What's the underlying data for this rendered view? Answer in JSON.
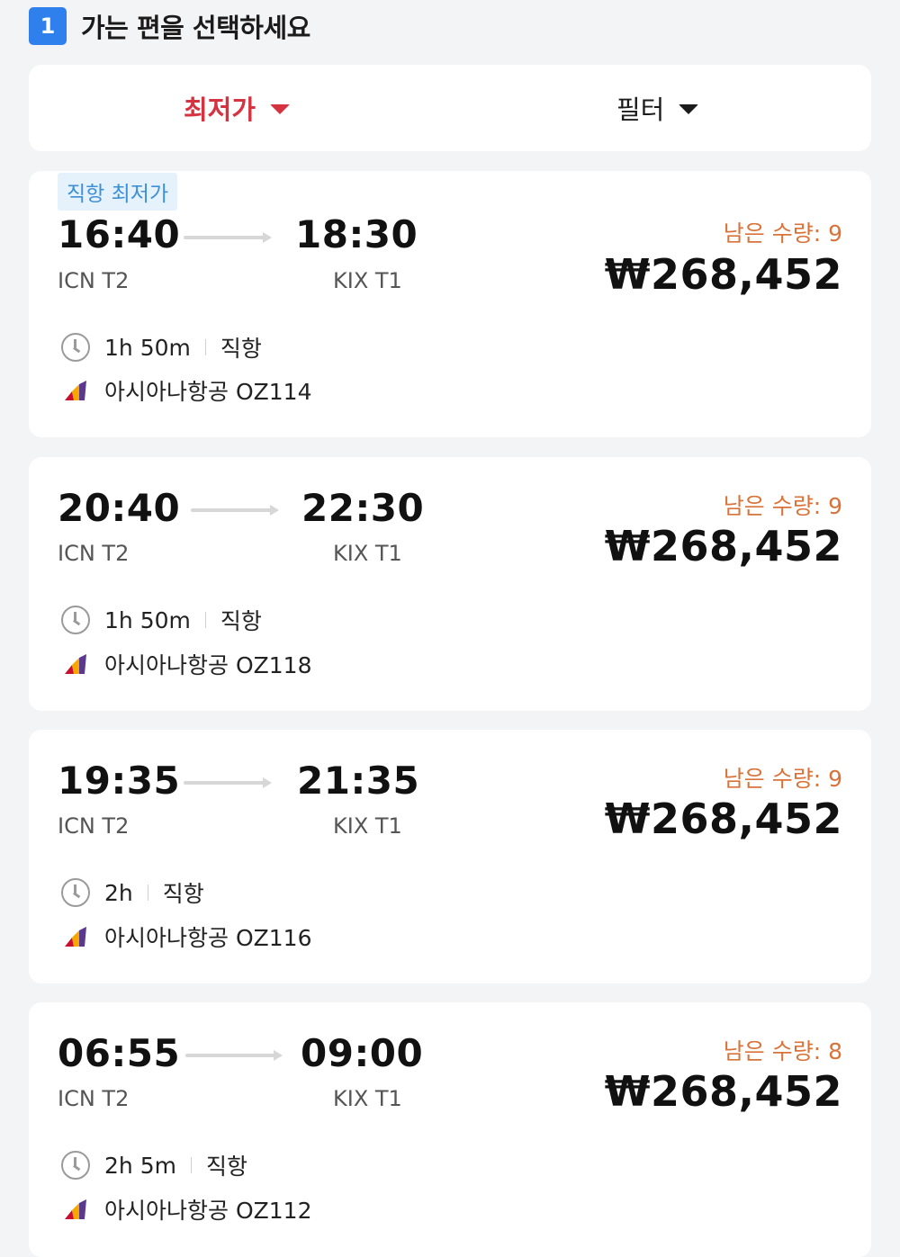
{
  "step": {
    "number": "1",
    "title": "가는 편을 선택하세요"
  },
  "sort": {
    "lowest_label": "최저가",
    "filter_label": "필터"
  },
  "colors": {
    "accent_red": "#d63340",
    "step_blue": "#2f80ed",
    "remain_orange": "#d9733a",
    "badge_blue": "#3d8fd6"
  },
  "flights": [
    {
      "badge": "직항 최저가",
      "depart_time": "16:40",
      "depart_airport": "ICN T2",
      "arrive_time": "18:30",
      "arrive_airport": "KIX T1",
      "remaining": "남은 수량: 9",
      "price": "₩268,452",
      "duration": "1h 50m",
      "type": "직항",
      "airline": "아시아나항공 OZ114"
    },
    {
      "badge": "",
      "depart_time": "20:40",
      "depart_airport": "ICN T2",
      "arrive_time": "22:30",
      "arrive_airport": "KIX T1",
      "remaining": "남은 수량: 9",
      "price": "₩268,452",
      "duration": "1h 50m",
      "type": "직항",
      "airline": "아시아나항공 OZ118"
    },
    {
      "badge": "",
      "depart_time": "19:35",
      "depart_airport": "ICN T2",
      "arrive_time": "21:35",
      "arrive_airport": "KIX T1",
      "remaining": "남은 수량: 9",
      "price": "₩268,452",
      "duration": "2h",
      "type": "직항",
      "airline": "아시아나항공 OZ116"
    },
    {
      "badge": "",
      "depart_time": "06:55",
      "depart_airport": "ICN T2",
      "arrive_time": "09:00",
      "arrive_airport": "KIX T1",
      "remaining": "남은 수량: 8",
      "price": "₩268,452",
      "duration": "2h 5m",
      "type": "직항",
      "airline": "아시아나항공 OZ112"
    }
  ]
}
